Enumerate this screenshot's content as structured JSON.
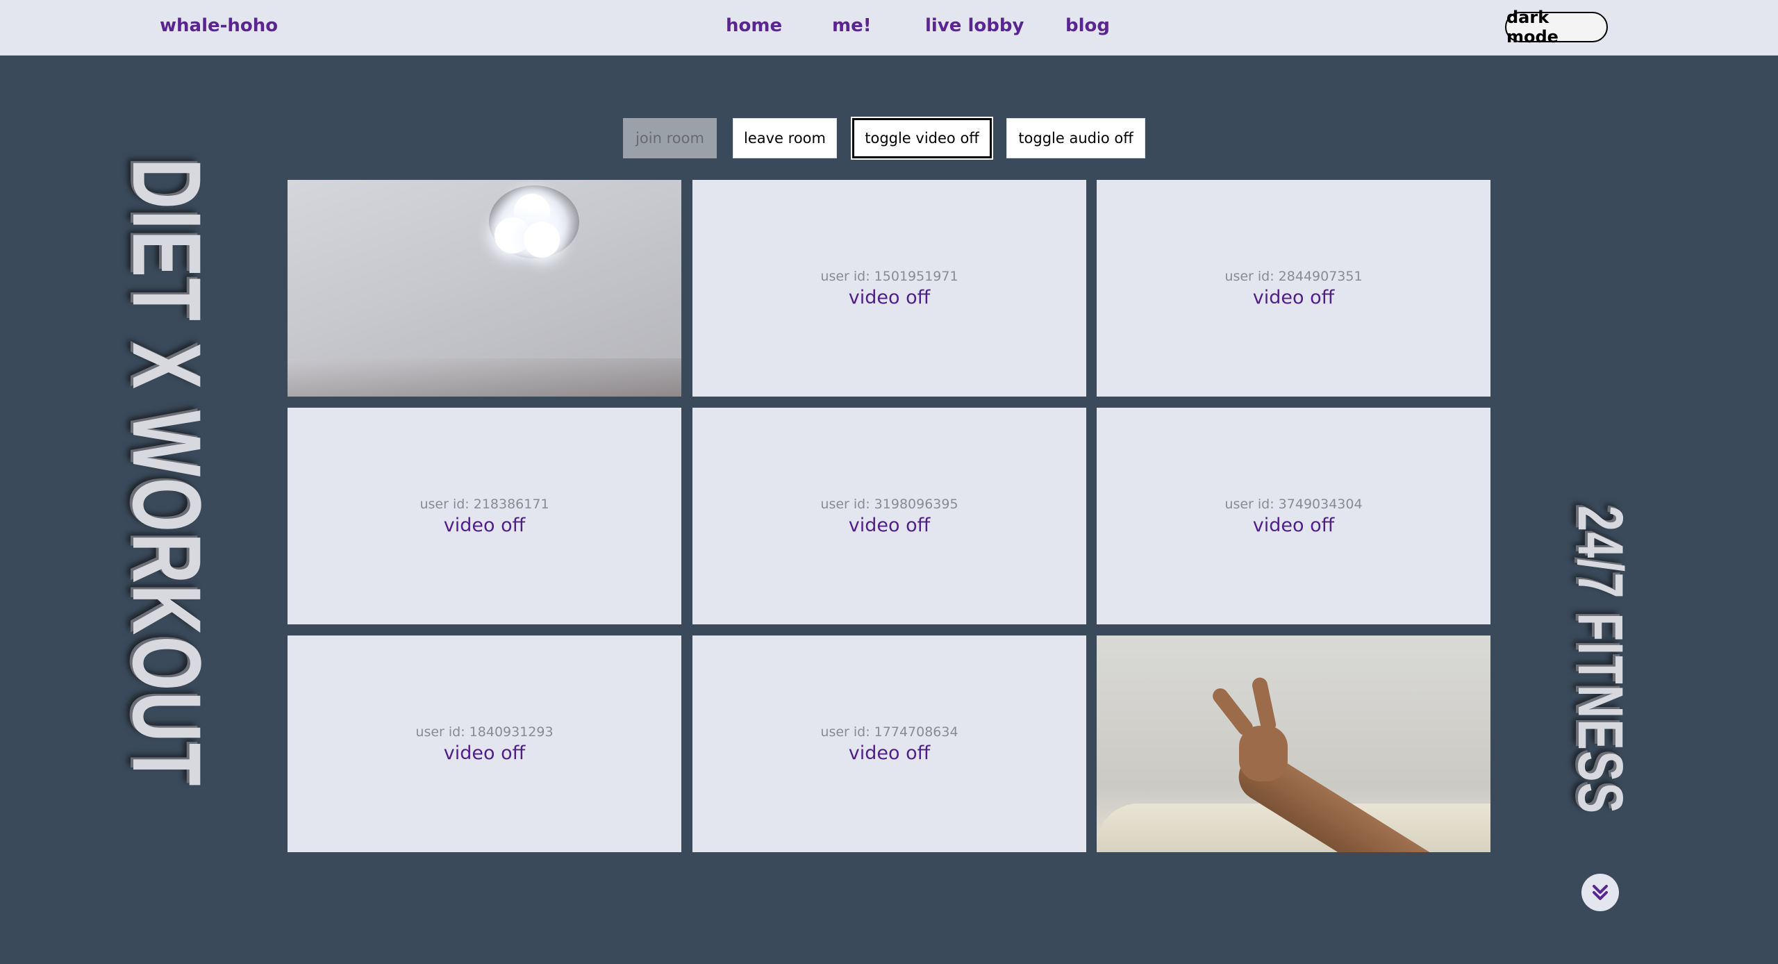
{
  "header": {
    "brand": "whale-hoho",
    "nav": [
      {
        "label": "home"
      },
      {
        "label": "me!"
      },
      {
        "label": "live lobby"
      },
      {
        "label": "blog"
      }
    ],
    "dark_mode_label": "dark mode"
  },
  "controls": {
    "join": "join room",
    "leave": "leave room",
    "toggle_video": "toggle video off",
    "toggle_audio": "toggle audio off"
  },
  "tiles": [
    {
      "type": "video",
      "scene": "ceiling-light"
    },
    {
      "type": "off",
      "user_id": "user id: 1501951971",
      "status": "video off"
    },
    {
      "type": "off",
      "user_id": "user id: 2844907351",
      "status": "video off"
    },
    {
      "type": "off",
      "user_id": "user id: 218386171",
      "status": "video off"
    },
    {
      "type": "off",
      "user_id": "user id: 3198096395",
      "status": "video off"
    },
    {
      "type": "off",
      "user_id": "user id: 3749034304",
      "status": "video off"
    },
    {
      "type": "off",
      "user_id": "user id: 1840931293",
      "status": "video off"
    },
    {
      "type": "off",
      "user_id": "user id: 1774708634",
      "status": "video off"
    },
    {
      "type": "video",
      "scene": "peace-sign-hand"
    }
  ],
  "side_banners": {
    "left": "DIET X WORKOUT",
    "right": "24/7 FITNESS"
  },
  "scroll_icon": "double-chevron-down-icon",
  "colors": {
    "background": "#3b4a5a",
    "header_bg": "#e3e6ee",
    "accent": "#5a2590",
    "tile_bg": "#e3e6ee"
  }
}
